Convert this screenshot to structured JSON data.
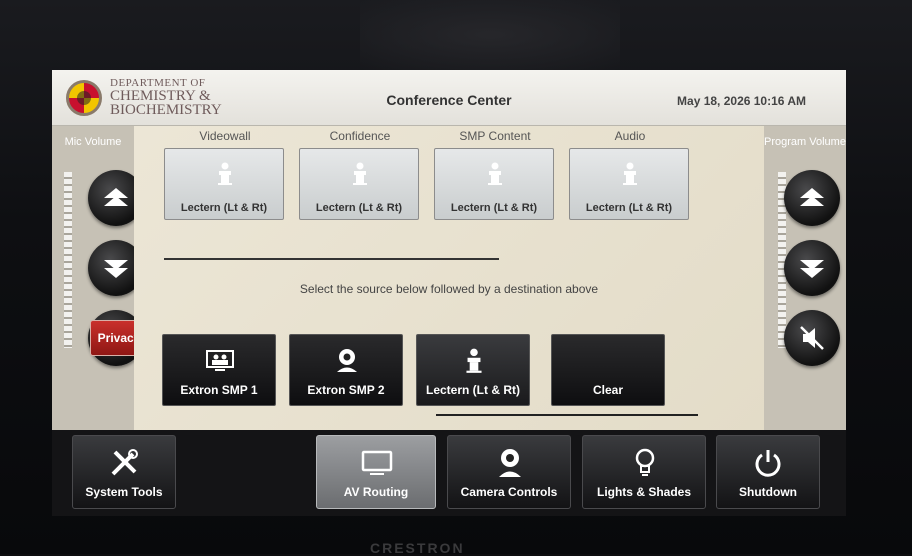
{
  "header": {
    "dept_line1": "DEPARTMENT OF",
    "dept_line2": "CHEMISTRY &",
    "dept_line3": "BIOCHEMISTRY",
    "room_title": "Conference Center",
    "datetime": "May 18, 2026 10:16 AM"
  },
  "mic_volume": {
    "label": "Mic Volume"
  },
  "program_volume": {
    "label": "Program Volume"
  },
  "privacy_label": "Privacy",
  "destinations": [
    {
      "label": "Videowall",
      "source": "Lectern (Lt & Rt)",
      "icon": "lectern-icon"
    },
    {
      "label": "Confidence",
      "source": "Lectern (Lt & Rt)",
      "icon": "lectern-icon"
    },
    {
      "label": "SMP Content",
      "source": "Lectern (Lt & Rt)",
      "icon": "lectern-icon"
    },
    {
      "label": "Audio",
      "source": "Lectern (Lt & Rt)",
      "icon": "lectern-icon"
    }
  ],
  "instruction": "Select the source below followed by a destination above",
  "sources": [
    {
      "label": "Extron SMP 1",
      "icon": "video-conference-icon"
    },
    {
      "label": "Extron SMP 2",
      "icon": "camera-icon"
    },
    {
      "label": "Lectern (Lt & Rt)",
      "icon": "lectern-icon",
      "selected": true
    },
    {
      "label": "Clear",
      "icon": ""
    }
  ],
  "nav": {
    "system_tools": "System Tools",
    "av_routing": "AV Routing",
    "camera_controls": "Camera Controls",
    "lights_shades": "Lights & Shades",
    "shutdown": "Shutdown"
  },
  "bezel_text": "CRESTRON"
}
